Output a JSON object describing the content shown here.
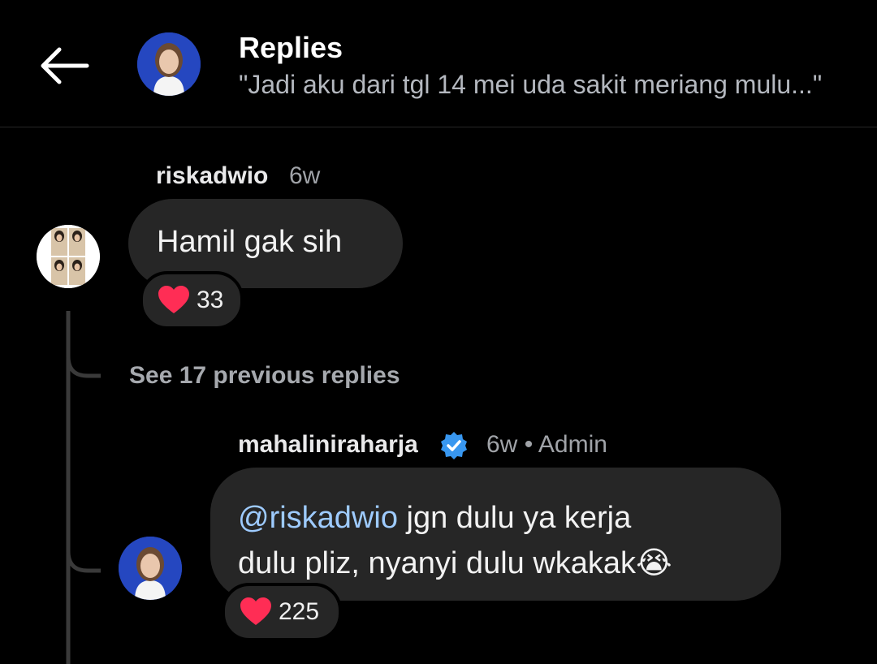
{
  "header": {
    "title": "Replies",
    "subtitle": "\"Jadi aku dari tgl 14 mei uda sakit meriang mulu...\""
  },
  "comments": [
    {
      "username": "riskadwio",
      "time": "6w",
      "text": "Hamil gak sih",
      "reaction_count": "33"
    }
  ],
  "see_previous": "See 17 previous replies",
  "reply": {
    "username": "mahaliniraharja",
    "time": "6w",
    "separator": "•",
    "role": "Admin",
    "mention": "@riskadwio",
    "text_line1": " jgn dulu ya kerja",
    "text_line2": "dulu pliz, nyanyi dulu wkakak",
    "emoji": "😭",
    "reaction_count": "225"
  },
  "icons": {
    "back": "arrow-left-icon",
    "verified": "verified-badge-icon",
    "heart": "heart-icon"
  },
  "colors": {
    "background": "#000000",
    "bubble": "#262626",
    "mention": "#9ecbff",
    "verified": "#3897f0",
    "heart": "#ff2d55"
  }
}
